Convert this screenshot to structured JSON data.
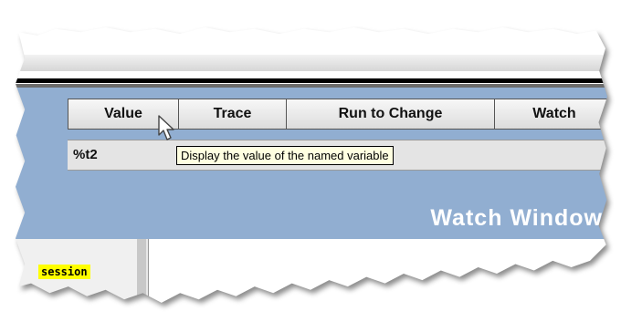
{
  "toolbar": {
    "value_label": "Value",
    "trace_label": "Trace",
    "run_to_change_label": "Run to Change",
    "watch_label": "Watch"
  },
  "variable": {
    "name": "%t2"
  },
  "tooltip": {
    "text": "Display the value of the named variable"
  },
  "panel": {
    "title": "Watch Window"
  },
  "session": {
    "label": "session"
  },
  "icons": {
    "cursor": "mouse-pointer-icon"
  },
  "colors": {
    "panel_bg": "#91aed1",
    "tooltip_bg": "#ffffe1",
    "highlight": "#ffff00"
  }
}
